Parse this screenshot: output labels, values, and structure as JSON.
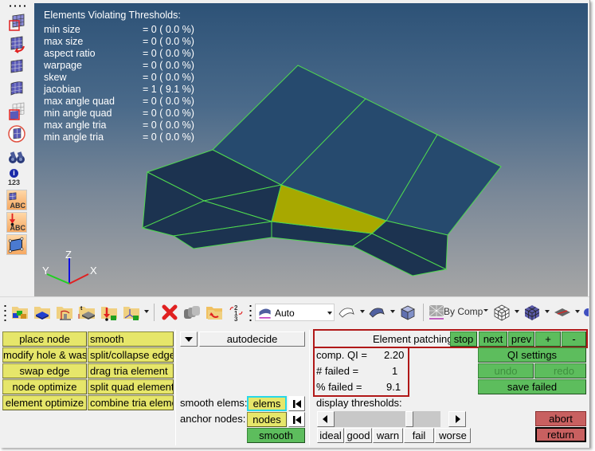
{
  "left_toolbar": {
    "icons": [
      {
        "name": "mesh-edit-select-icon"
      },
      {
        "name": "mesh-undo-icon"
      },
      {
        "name": "mesh-grid-icon"
      },
      {
        "name": "mesh-surface-icon"
      },
      {
        "name": "mesh-element-select-icon"
      },
      {
        "name": "mesh-circle-select-icon"
      },
      {
        "name": "binoculars-icon"
      },
      {
        "name": "info-123-icon"
      },
      {
        "name": "element-abc-icon"
      },
      {
        "name": "load-abc-icon"
      },
      {
        "name": "quad-element-icon"
      }
    ],
    "info_number": "123",
    "abc_label": "ABC"
  },
  "viewport": {
    "stats_title": "Elements Violating Thresholds:",
    "stats": [
      {
        "label": "min size",
        "value": "= 0 ( 0.0 %)"
      },
      {
        "label": "max size",
        "value": "= 0 ( 0.0 %)"
      },
      {
        "label": "aspect ratio",
        "value": "= 0 ( 0.0 %)"
      },
      {
        "label": "warpage",
        "value": "= 0 ( 0.0 %)"
      },
      {
        "label": "skew",
        "value": "= 0 ( 0.0 %)"
      },
      {
        "label": "jacobian",
        "value": "= 1 ( 9.1 %)"
      },
      {
        "label": "max angle quad",
        "value": "= 0 ( 0.0 %)"
      },
      {
        "label": "min angle quad",
        "value": "= 0 ( 0.0 %)"
      },
      {
        "label": "max angle tria",
        "value": "= 0 ( 0.0 %)"
      },
      {
        "label": "min angle tria",
        "value": "= 0 ( 0.0 %)"
      }
    ],
    "axis_labels": {
      "x": "X",
      "y": "Y",
      "z": "Z"
    },
    "colors": {
      "mesh_fill": "#264a6e",
      "mesh_fill_dark": "#1c3350",
      "mesh_edge": "#4fd84f",
      "failed_element": "#a8a800"
    }
  },
  "toolbar": {
    "display_mode": "Auto",
    "color_mode": "By Comp",
    "icons": [
      "component-folder-icon",
      "element-folder-icon",
      "load-collector-icon",
      "thickness-icon",
      "constraint-icon",
      "system-icon",
      "delete-icon",
      "copy-icon",
      "undo-folder-icon",
      "renumber-icon",
      "shaded-icon",
      "wireframe-surface-icon",
      "shaded-surface-icon",
      "solid-cube-icon",
      "color-by-icon",
      "wireframe-elements-icon",
      "shaded-elements-icon",
      "cut-plane-icon"
    ]
  },
  "panel": {
    "left_buttons": [
      [
        "place node",
        "smooth"
      ],
      [
        "modify hole & washer",
        "split/collapse edge"
      ],
      [
        "swap edge",
        "drag tria element"
      ],
      [
        "node optimize",
        "split quad element"
      ],
      [
        "element optimize",
        "combine tria elements"
      ]
    ],
    "mode_select": "autodecide",
    "smooth_elems_label": "smooth elems:",
    "smooth_elems_value": "elems",
    "anchor_nodes_label": "anchor nodes:",
    "anchor_nodes_value": "nodes",
    "smooth_button": "smooth",
    "patching": {
      "label": "Element patching",
      "stop": "stop",
      "next": "next",
      "prev": "prev",
      "plus": "+",
      "minus": "-"
    },
    "qi": {
      "comp_qi_label": "comp. QI =",
      "comp_qi_value": "2.20",
      "failed_label": "# failed =",
      "failed_value": "1",
      "pct_failed_label": "% failed =",
      "pct_failed_value": "9.1"
    },
    "qi_settings": "QI settings",
    "undo": "undo",
    "redo": "redo",
    "save_failed": "save failed",
    "display_thresholds_label": "display thresholds:",
    "threshold_slider_position": 0.72,
    "threshold_buttons": [
      "ideal",
      "good",
      "warn",
      "fail",
      "worse"
    ],
    "abort": "abort",
    "return": "return"
  }
}
